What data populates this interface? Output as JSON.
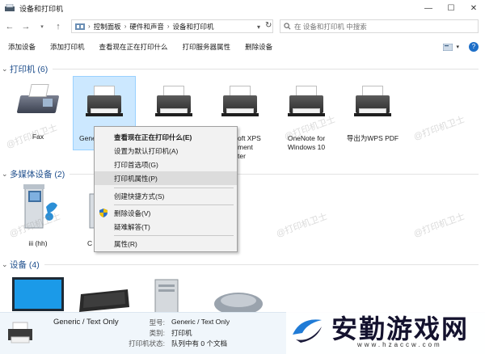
{
  "window": {
    "title": "设备和打印机",
    "controls": {
      "minimize": "—",
      "maximize": "☐",
      "close": "✕"
    }
  },
  "nav": {
    "back": "←",
    "forward": "→",
    "up": "↑"
  },
  "address": {
    "crumbs": [
      "控制面板",
      "硬件和声音",
      "设备和打印机"
    ],
    "separator": "›"
  },
  "search": {
    "placeholder": "在 设备和打印机 中搜索"
  },
  "commands": [
    "添加设备",
    "添加打印机",
    "查看现在正在打印什么",
    "打印服务器属性",
    "删除设备"
  ],
  "groups": {
    "printers": {
      "name": "打印机 (6)",
      "items": [
        {
          "label": "Fax",
          "icon": "fax-icon"
        },
        {
          "label": "Gene",
          "icon": "printer-icon",
          "selected": true
        },
        {
          "label": "",
          "icon": "printer-icon"
        },
        {
          "label": "oft XPS\nment\nter",
          "icon": "printer-icon"
        },
        {
          "label": "OneNote for\nWindows 10",
          "icon": "printer-icon"
        },
        {
          "label": "导出为WPS PDF",
          "icon": "printer-icon"
        }
      ]
    },
    "multimedia": {
      "name": "多媒体设备 (2)",
      "items": [
        {
          "label": "iii (hh)",
          "icon": "media-server-icon"
        },
        {
          "label": "C",
          "icon": "media-server-icon"
        }
      ]
    },
    "devices": {
      "name": "设备 (4)"
    }
  },
  "context_menu": {
    "items": [
      {
        "label": "查看现在正在打印什么(E)",
        "bold": true
      },
      {
        "label": "设置为默认打印机(A)"
      },
      {
        "label": "打印首选项(G)"
      },
      {
        "label": "打印机属性(P)",
        "highlighted": true
      },
      {
        "label": "创建快捷方式(S)"
      },
      {
        "label": "删除设备(V)",
        "icon": "shield-icon"
      },
      {
        "label": "疑难解答(T)"
      },
      {
        "label": "属性(R)"
      }
    ]
  },
  "details": {
    "name": "Generic / Text Only",
    "fields": [
      {
        "label": "型号:",
        "value": "Generic / Text Only"
      },
      {
        "label": "类别:",
        "value": "打印机"
      },
      {
        "label": "打印机状态:",
        "value": "队列中有 0 个文档"
      }
    ]
  },
  "watermark": "@打印机卫士",
  "logo": {
    "text": "安勤游戏网",
    "url": "www.hzaccw.com"
  },
  "colors": {
    "accent": "#1e4e8c",
    "selection": "#cce8ff",
    "menu_bg": "#f2f2f2"
  }
}
